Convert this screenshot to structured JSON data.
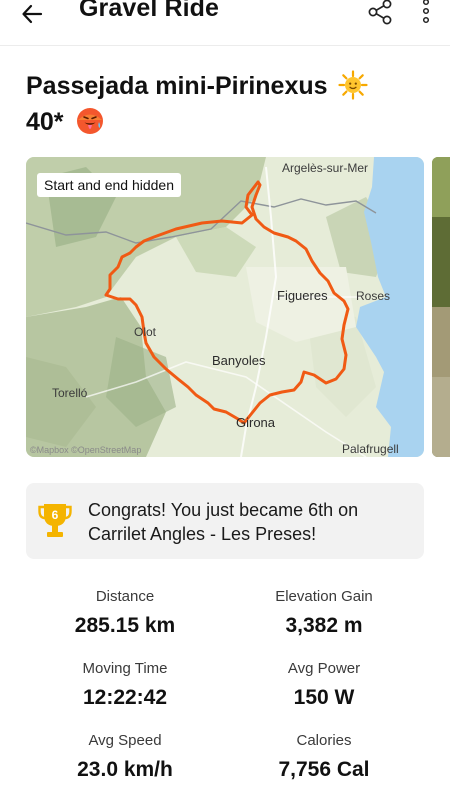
{
  "header": {
    "title": "Gravel Ride",
    "back_icon": "arrow-left-icon",
    "share_icon": "share-icon",
    "more_icon": "more-vertical-icon"
  },
  "activity": {
    "title_line1": "Passejada mini-Pirinexus",
    "title_line2": "40*",
    "emoji_1": "sun-emoji-icon",
    "emoji_2": "hot-face-emoji-icon"
  },
  "map": {
    "privacy_badge": "Start and end hidden",
    "places": {
      "argeles": "Argelès-sur-Mer",
      "figueres": "Figueres",
      "roses": "Roses",
      "olot": "Olot",
      "banyoles": "Banyoles",
      "torello": "Torelló",
      "girona": "Girona",
      "palafrugell": "Palafrugell"
    },
    "attribution": "©Mapbox ©OpenStreetMap",
    "colors": {
      "route": "#f05a14",
      "sea": "#a9d3f0",
      "land": "#e6ecd8"
    }
  },
  "achievement": {
    "rank": "6",
    "text": "Congrats! You just became 6th on Carrilet Angles - Les Preses!",
    "trophy_color": "#f4b400"
  },
  "stats": [
    {
      "label": "Distance",
      "value": "285.15 km"
    },
    {
      "label": "Elevation Gain",
      "value": "3,382 m"
    },
    {
      "label": "Moving Time",
      "value": "12:22:42"
    },
    {
      "label": "Avg Power",
      "value": "150 W"
    },
    {
      "label": "Avg Speed",
      "value": "23.0 km/h"
    },
    {
      "label": "Calories",
      "value": "7,756 Cal"
    }
  ]
}
